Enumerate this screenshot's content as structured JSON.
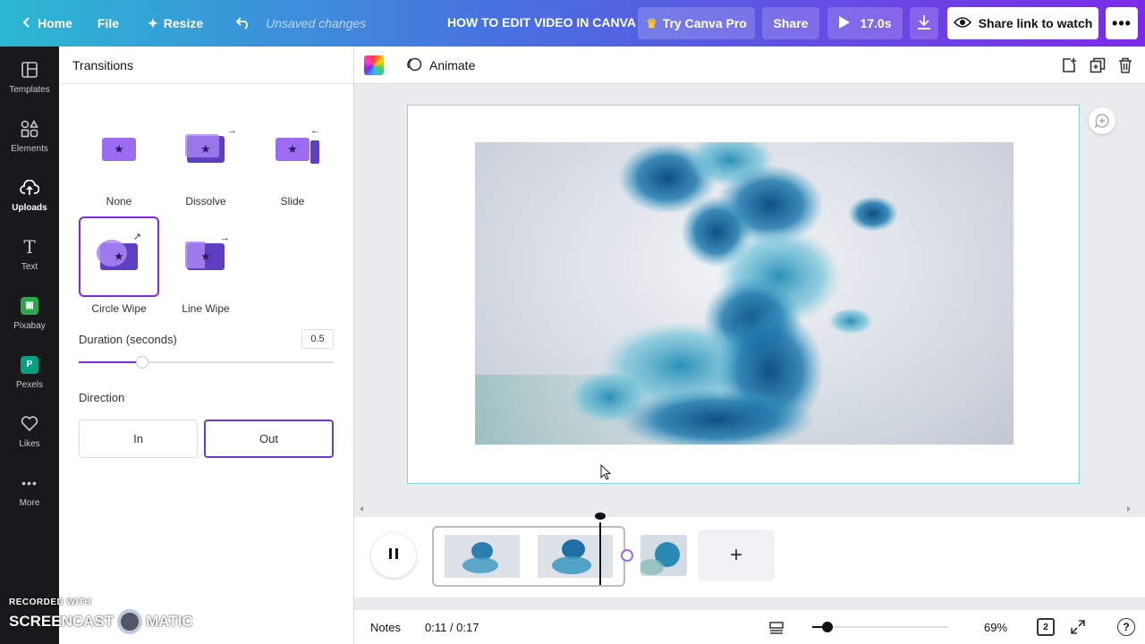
{
  "topbar": {
    "home": "Home",
    "file": "File",
    "resize": "Resize",
    "unsaved": "Unsaved changes",
    "title": "HOW TO EDIT VIDEO IN CANVA",
    "try_pro": "Try Canva Pro",
    "share": "Share",
    "play_duration": "17.0s",
    "share_link": "Share link to watch"
  },
  "rail": {
    "items": [
      {
        "label": "Templates",
        "icon": "templates-icon"
      },
      {
        "label": "Elements",
        "icon": "elements-icon"
      },
      {
        "label": "Uploads",
        "icon": "uploads-icon"
      },
      {
        "label": "Text",
        "icon": "text-icon"
      },
      {
        "label": "Pixabay",
        "icon": "pixabay-icon"
      },
      {
        "label": "Pexels",
        "icon": "pexels-icon"
      },
      {
        "label": "Likes",
        "icon": "heart-icon"
      },
      {
        "label": "More",
        "icon": "more-icon"
      }
    ],
    "active": "Uploads"
  },
  "watermark": {
    "top": "RECORDED WITH",
    "left": "SCREENCAST",
    "right": "MATIC"
  },
  "panel": {
    "title": "Transitions",
    "transitions": [
      {
        "label": "None"
      },
      {
        "label": "Dissolve"
      },
      {
        "label": "Slide"
      },
      {
        "label": "Circle Wipe"
      },
      {
        "label": "Line Wipe"
      }
    ],
    "selected": "Circle Wipe",
    "duration_label": "Duration (seconds)",
    "duration_value": "0.5",
    "duration_fraction": 0.25,
    "direction_label": "Direction",
    "direction_in": "In",
    "direction_out": "Out",
    "direction_selected": "Out"
  },
  "toolbar": {
    "animate": "Animate"
  },
  "timeline": {
    "progress_fraction": 0.65
  },
  "bottom": {
    "notes": "Notes",
    "time": "0:11 / 0:17",
    "zoom": "69%",
    "zoom_fraction": 0.11,
    "pages": "2",
    "help": "?"
  },
  "colors": {
    "accent": "#7d2ae8",
    "ink": "#1a6fa0"
  }
}
